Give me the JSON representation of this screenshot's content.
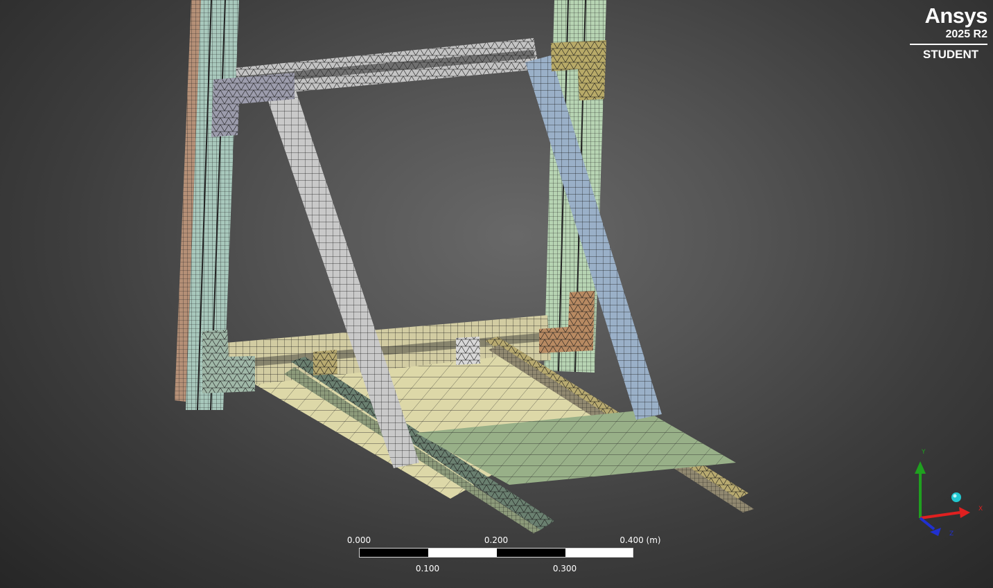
{
  "logo": {
    "brand": "Ansys",
    "version": "2025 R2",
    "edition": "STUDENT"
  },
  "scale_bar": {
    "top_labels": [
      "0.000",
      "0.200",
      "0.400 (m)"
    ],
    "bottom_labels": [
      "0.100",
      "0.300"
    ]
  },
  "triad": {
    "axes": {
      "x": "X",
      "y": "Y",
      "z": "Z"
    },
    "colors": {
      "x": "#e02020",
      "y": "#1fa01f",
      "z": "#2030d0",
      "iso_ball": "#22c8d0"
    }
  },
  "mesh_colors": {
    "left_post_outer": "#b59077",
    "left_post_inner": "#a8c8bc",
    "right_post": "#b7d4b3",
    "top_beam": "#c8c8c8",
    "bottom_beam": "#d8d2a8",
    "left_brace": "#c9c9c9",
    "right_brace": "#9ab0c8",
    "top_left_gusset": "#9c9cac",
    "top_right_gusset": "#b8aa68",
    "bottom_left_gusset": "#a0b8a8",
    "bottom_right_gusset": "#b88a62",
    "base_plate": "#ddd8a8",
    "foot_plate": "#98b088",
    "rail_left": "#6a8070",
    "rail_right": "#b8aa70",
    "mesh_line": "#1a1a1a"
  }
}
